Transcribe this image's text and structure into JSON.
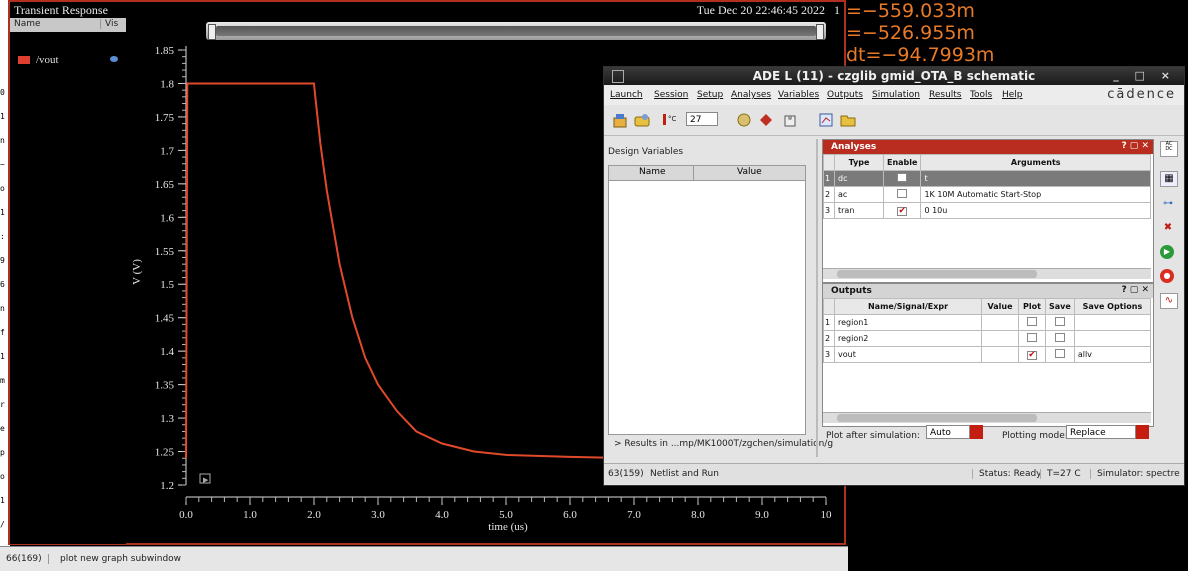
{
  "left_strip": {
    "chars": [
      "0",
      "1",
      "n",
      "~",
      "o",
      "1",
      ":",
      "9",
      "6",
      "n",
      "f",
      "1",
      "m",
      "r",
      "e",
      "p",
      "o",
      "1",
      "/"
    ]
  },
  "waveform": {
    "title": "Transient Response",
    "datetime": "Tue Dec 20 22:46:45 2022",
    "page": "1",
    "legend": {
      "col_name": "Name",
      "col_vis": "Vis",
      "signal": "/vout"
    },
    "y_axis_label": "V (V)",
    "x_axis_label": "time (us)",
    "y_ticks": [
      "1.85",
      "1.8",
      "1.75",
      "1.7",
      "1.65",
      "1.6",
      "1.55",
      "1.5",
      "1.45",
      "1.4",
      "1.35",
      "1.3",
      "1.25",
      "1.2"
    ],
    "x_ticks": [
      "0.0",
      "1.0",
      "2.0",
      "3.0",
      "4.0",
      "5.0",
      "6.0",
      "7.0",
      "8.0",
      "9.0",
      "10"
    ],
    "status_num": "66(169)",
    "status_msg": "plot new graph subwindow"
  },
  "chart_data": {
    "type": "line",
    "xlabel": "time (us)",
    "ylabel": "V (V)",
    "xlim": [
      0,
      10
    ],
    "ylim": [
      1.2,
      1.85
    ],
    "series": [
      {
        "name": "/vout",
        "color": "#e04a2a",
        "x": [
          0.0,
          0.02,
          0.04,
          2.0,
          2.02,
          2.1,
          2.2,
          2.4,
          2.6,
          2.8,
          3.0,
          3.3,
          3.6,
          4.0,
          4.5,
          5.0,
          6.0,
          7.0,
          8.0,
          10.0
        ],
        "y": [
          1.24,
          1.8,
          1.8,
          1.8,
          1.78,
          1.71,
          1.64,
          1.53,
          1.45,
          1.39,
          1.35,
          1.31,
          1.28,
          1.262,
          1.25,
          1.245,
          1.242,
          1.24,
          1.24,
          1.24
        ]
      }
    ]
  },
  "right_readout": {
    "lines": [
      "=−559.033m",
      "=−526.955m",
      "dt=−94.7993m"
    ]
  },
  "ade": {
    "title": "ADE L (11) - czglib gmid_OTA_B schematic",
    "window_buttons": "_ □ ×",
    "menus": [
      "Launch",
      "Session",
      "Setup",
      "Analyses",
      "Variables",
      "Outputs",
      "Simulation",
      "Results",
      "Tools",
      "Help"
    ],
    "brand": "cādence",
    "temperature": "27",
    "design_vars": {
      "label": "Design Variables",
      "col_name": "Name",
      "col_value": "Value"
    },
    "results_path": "> Results in ...mp/MK1000T/zgchen/simulation/g",
    "analyses": {
      "title": "Analyses",
      "headers": [
        "Type",
        "Enable",
        "Arguments"
      ],
      "rows": [
        {
          "n": "1",
          "type": "dc",
          "enabled": false,
          "args": "t"
        },
        {
          "n": "2",
          "type": "ac",
          "enabled": false,
          "args": "1K 10M Automatic Start-Stop"
        },
        {
          "n": "3",
          "type": "tran",
          "enabled": true,
          "args": "0 10u"
        }
      ]
    },
    "outputs": {
      "title": "Outputs",
      "headers": [
        "Name/Signal/Expr",
        "Value",
        "Plot",
        "Save",
        "Save Options"
      ],
      "rows": [
        {
          "n": "1",
          "name": "region1",
          "value": "",
          "plot": false,
          "save": false,
          "opts": ""
        },
        {
          "n": "2",
          "name": "region2",
          "value": "",
          "plot": false,
          "save": false,
          "opts": ""
        },
        {
          "n": "3",
          "name": "vout",
          "value": "",
          "plot": true,
          "save": false,
          "opts": "allv"
        }
      ]
    },
    "plot_after_label": "Plot after simulation:",
    "plot_after_value": "Auto",
    "plotting_mode_label": "Plotting mode:",
    "plotting_mode_value": "Replace",
    "status": {
      "num": "63(159)",
      "msg": "Netlist and Run",
      "ready": "Status: Ready",
      "temp": "T=27 C",
      "sim": "Simulator: spectre"
    }
  }
}
